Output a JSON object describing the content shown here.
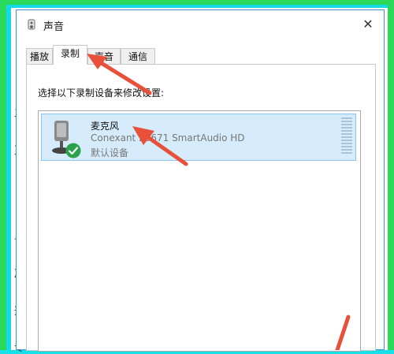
{
  "window": {
    "title": "声音",
    "close_glyph": "✕"
  },
  "tabs": [
    {
      "label": "播放",
      "active": false
    },
    {
      "label": "录制",
      "active": true
    },
    {
      "label": "声音",
      "active": false
    },
    {
      "label": "通信",
      "active": false
    }
  ],
  "panel": {
    "instruction": "选择以下录制设备来修改设置:"
  },
  "devices": [
    {
      "name": "麦克风",
      "description": "Conexant 20671 SmartAudio HD",
      "status": "默认设备",
      "icon": "microphone-icon",
      "default_badge": "checkmark-icon"
    }
  ],
  "background_window": {
    "partial_chars": [
      "主",
      "灭",
      "显",
      "声",
      "通",
      "专"
    ]
  },
  "colors": {
    "accent_border": "#3f8fd6",
    "selection": "#d6ebfb",
    "annotation_arrow": "#e8503a",
    "frame_green": "#2bd95a",
    "frame_cyan": "#16d9e8"
  }
}
